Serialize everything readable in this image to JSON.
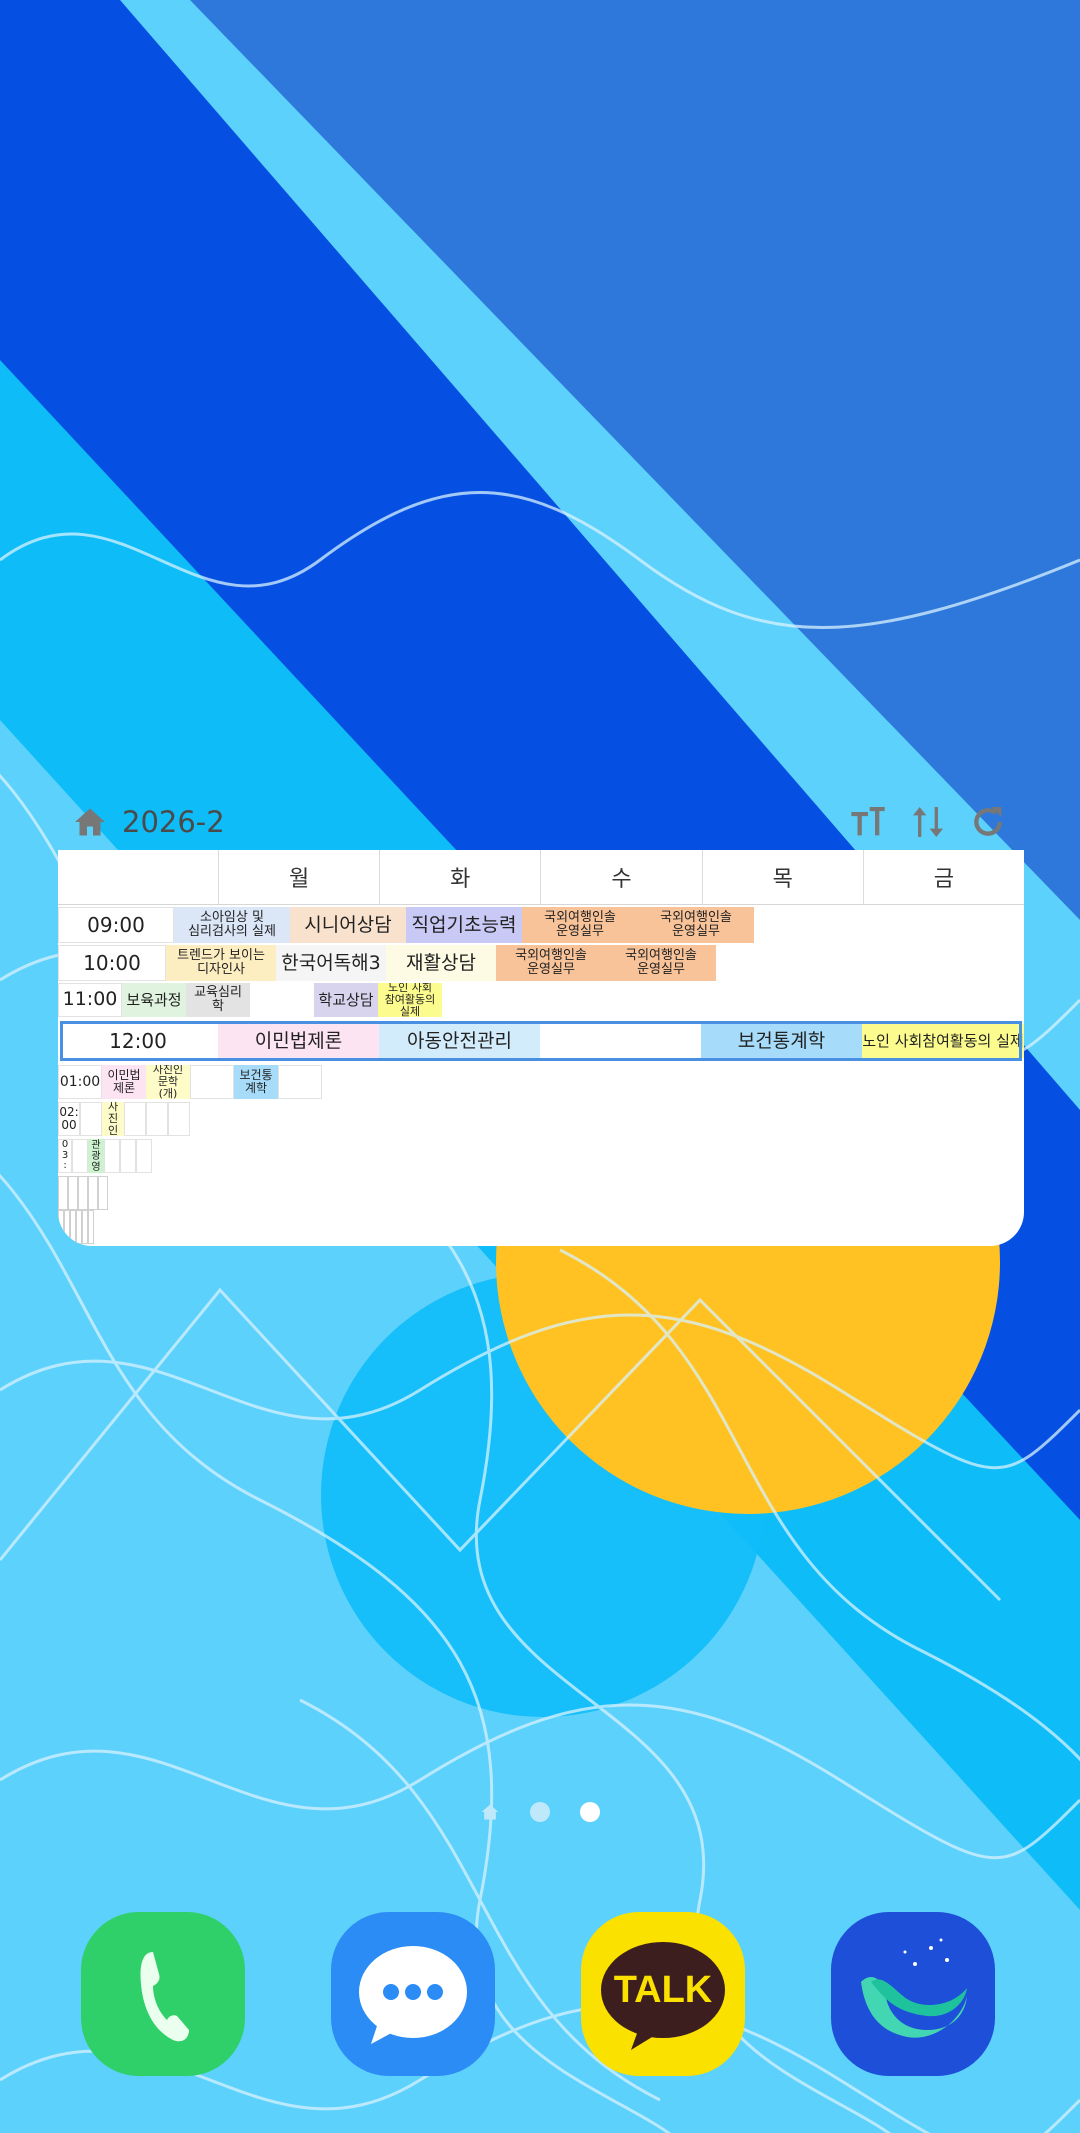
{
  "widget": {
    "semester": "2026-2",
    "days": [
      "월",
      "화",
      "수",
      "목",
      "금"
    ]
  },
  "timetable": {
    "row1": {
      "time": "09:00",
      "cells": [
        {
          "label": "소아임상 및\n심리검사의 실제",
          "color": "#dbe6f7"
        },
        {
          "label": "시니어상담",
          "color": "#f9e2cd"
        },
        {
          "label": "직업기초능력",
          "color": "#c9c9f5"
        },
        {
          "label": "국외여행인솔\n운영실무",
          "color": "#f9c39a"
        },
        {
          "label": "국외여행인솔\n운영실무",
          "color": "#f9c39a"
        }
      ]
    },
    "row2": {
      "time": "10:00",
      "cells": [
        {
          "label": "트렌드가 보이는\n디자인사",
          "color": "#fdeec2"
        },
        {
          "label": "한국어독해3",
          "color": "#f5f5f5"
        },
        {
          "label": "재활상담",
          "color": "#fdfbe3"
        },
        {
          "label": "국외여행인솔\n운영실무",
          "color": "#f9c39a"
        },
        {
          "label": "국외여행인솔\n운영실무",
          "color": "#f9c39a"
        }
      ]
    },
    "row3": {
      "time": "11:00",
      "cells": [
        {
          "label": "보육과정",
          "color": "#dff3de"
        },
        {
          "label": "교육심리\n학",
          "color": "#e3e3e3"
        },
        {
          "label": "",
          "color": "#ffffff"
        },
        {
          "label": "학교상담",
          "color": "#d8d4ee"
        },
        {
          "label": "노인 사회\n참여활동의\n실제",
          "color": "#fcfc8e"
        }
      ]
    },
    "row4": {
      "time": "12:00",
      "cells": [
        {
          "label": "이민법제론",
          "color": "#fde4f3"
        },
        {
          "label": "아동안전관리",
          "color": "#d3ecfb"
        },
        {
          "label": "",
          "color": "#ffffff"
        },
        {
          "label": "보건통계학",
          "color": "#a6dcfa"
        },
        {
          "label": "노인 사회참여활동의 실제",
          "color": "#fcfc8e"
        }
      ]
    },
    "row5": {
      "time": "01:00",
      "cells": [
        {
          "label": "이민법\n제론",
          "color": "#fde4f3"
        },
        {
          "label": "사진인\n문학\n(개)",
          "color": "#fdfbc8"
        },
        {
          "label": "",
          "color": "#ffffff"
        },
        {
          "label": "보건통\n계학",
          "color": "#a6dcfa"
        },
        {
          "label": "",
          "color": "#ffffff"
        }
      ]
    },
    "row6": {
      "time": "02:\n00",
      "cells": [
        {
          "label": "",
          "color": "#ffffff"
        },
        {
          "label": "사\n진\n인",
          "color": "#fdfbc8"
        },
        {
          "label": "",
          "color": "#ffffff"
        },
        {
          "label": "",
          "color": "#ffffff"
        },
        {
          "label": "",
          "color": "#ffffff"
        }
      ]
    },
    "row7": {
      "time": "0\n3\n:",
      "cells": [
        {
          "label": "",
          "color": "#ffffff"
        },
        {
          "label": "관\n광\n영",
          "color": "#cdf2cf"
        },
        {
          "label": "",
          "color": "#ffffff"
        },
        {
          "label": "",
          "color": "#ffffff"
        },
        {
          "label": "",
          "color": "#ffffff"
        }
      ]
    }
  },
  "icons": {
    "home": "home-icon",
    "font": "text-size-icon",
    "sort": "sort-arrows-icon",
    "refresh": "refresh-icon"
  },
  "dock": [
    {
      "name": "phone-app",
      "color": "#2fd06a"
    },
    {
      "name": "messages-app",
      "color": "#2c8cf5"
    },
    {
      "name": "kakaotalk-app",
      "color": "#fae100",
      "label": "TALK"
    },
    {
      "name": "naver-whale-app",
      "color": "#1e4fd8"
    }
  ],
  "colors": {
    "wallpaper_light": "#5cd1fb",
    "wallpaper_mid": "#0ebdf8",
    "wallpaper_dark": "#0550e3",
    "wallpaper_top": "#2e78dc",
    "sun": "#ffc222",
    "highlight": "#4a90e2"
  }
}
